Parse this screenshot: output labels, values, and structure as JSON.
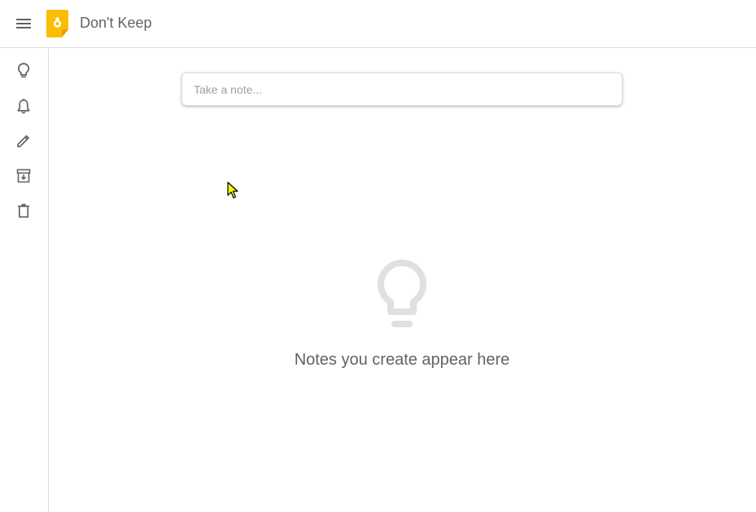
{
  "header": {
    "app_title": "Don't Keep",
    "menu_icon": "hamburger-menu-icon",
    "logo_icon": "keep-logo-icon",
    "logo_color": "#fbbc04"
  },
  "sidebar": {
    "items": [
      {
        "icon": "lightbulb-icon",
        "label": "Notes"
      },
      {
        "icon": "bell-icon",
        "label": "Reminders"
      },
      {
        "icon": "pencil-icon",
        "label": "Edit labels"
      },
      {
        "icon": "archive-icon",
        "label": "Archive"
      },
      {
        "icon": "trash-icon",
        "label": "Trash"
      }
    ]
  },
  "main": {
    "note_input": {
      "placeholder": "Take a note...",
      "value": ""
    },
    "empty_state": {
      "icon": "lightbulb-icon",
      "message": "Notes you create appear here"
    }
  }
}
